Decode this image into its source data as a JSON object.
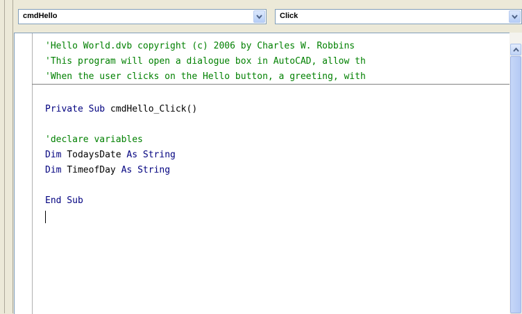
{
  "object_combo": {
    "value": "cmdHello"
  },
  "procedure_combo": {
    "value": "Click"
  },
  "code": {
    "header_comments": [
      "'Hello World.dvb copyright (c) 2006 by Charles W. Robbins",
      "'This program will open a dialogue box in AutoCAD, allow th",
      "'When the user clicks on the Hello button, a greeting, with"
    ],
    "sub_kw1": "Private Sub",
    "sub_name": "cmdHello_Click()",
    "comment_declare": "'declare variables",
    "dim_kw": "Dim",
    "var1": "TodaysDate",
    "var2": "TimeofDay",
    "as_kw": "As",
    "type": "String",
    "end_sub": "End Sub"
  },
  "colors": {
    "comment": "#008000",
    "keyword": "#00007f"
  },
  "icons": {
    "combo_dropdown": "chevron-down-icon",
    "scroll_up": "chevron-up-icon"
  }
}
